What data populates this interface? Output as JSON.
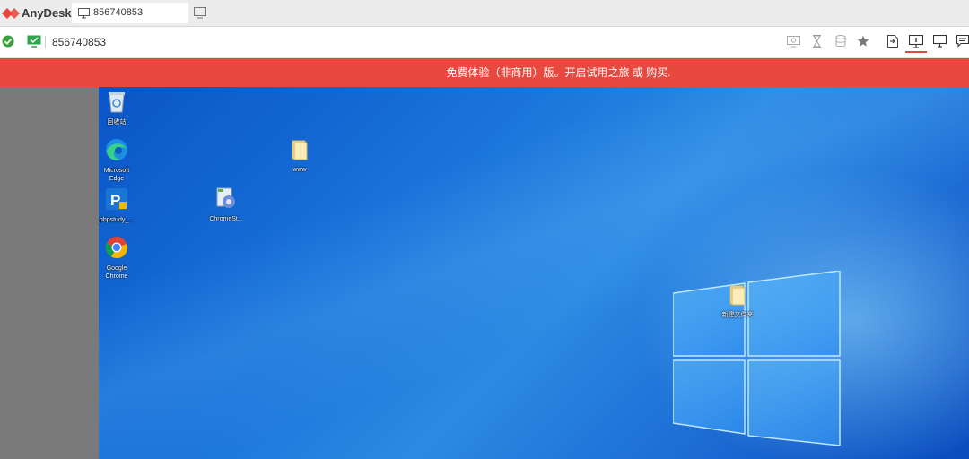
{
  "app": {
    "name": "AnyDesk",
    "brand_color": "#e8453c"
  },
  "tab": {
    "label": "856740853",
    "icon": "monitor-icon"
  },
  "address": {
    "id": "856740853",
    "status_icon": "check-circle-icon",
    "connection_icon": "monitor-green-icon"
  },
  "toolbar_icons": [
    "display-settings-icon",
    "hourglass-icon",
    "database-icon",
    "star-icon",
    "file-transfer-icon",
    "action-icon",
    "monitor-icon",
    "chat-icon"
  ],
  "banner": {
    "text": "免费体验（非商用）版。开启试用之旅 或 购买.",
    "color": "#e8493f"
  },
  "desktop": {
    "icons": [
      {
        "name": "recycle-bin-icon",
        "label1": "回收站",
        "label2": ""
      },
      {
        "name": "edge-icon",
        "label1": "Microsoft",
        "label2": "Edge"
      },
      {
        "name": "phpstudy-icon",
        "label1": "phpstudy_...",
        "label2": ""
      },
      {
        "name": "chrome-icon",
        "label1": "Google",
        "label2": "Chrome"
      },
      {
        "name": "folder-icon",
        "label1": "www",
        "label2": ""
      },
      {
        "name": "setup-icon",
        "label1": "ChromeSt...",
        "label2": ""
      },
      {
        "name": "new-folder-icon",
        "label1": "新建文件夹",
        "label2": ""
      }
    ]
  }
}
